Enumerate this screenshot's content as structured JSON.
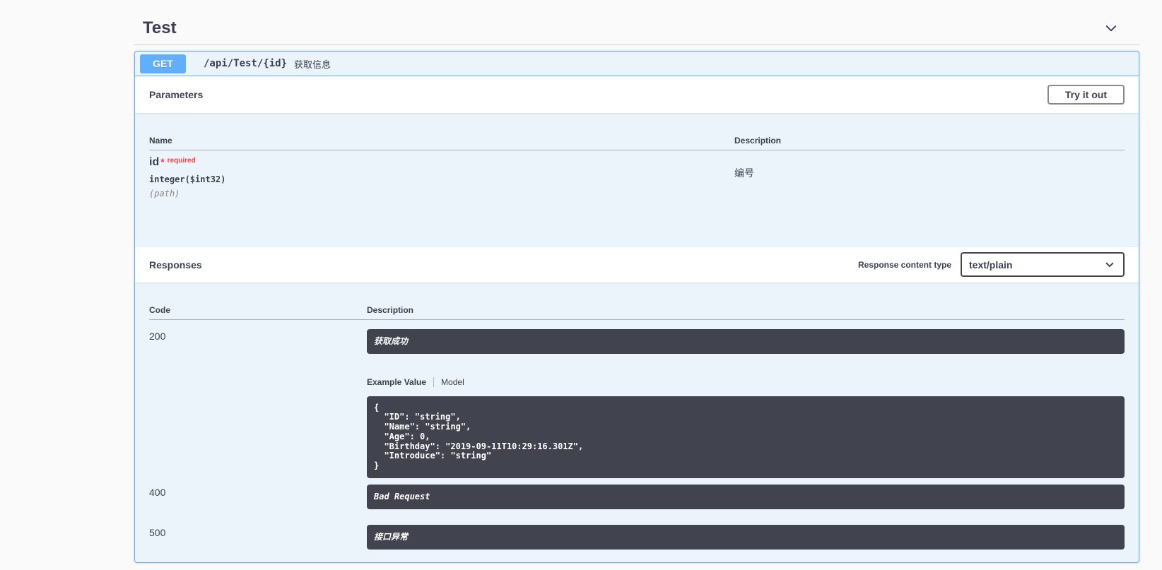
{
  "page": {
    "tag_title": "Test"
  },
  "operation": {
    "method": "GET",
    "path": "/api/Test/{id}",
    "summary": "获取信息"
  },
  "parameters": {
    "title": "Parameters",
    "try_it_out": "Try it out",
    "columns": {
      "name": "Name",
      "description": "Description"
    },
    "items": [
      {
        "name": "id",
        "required_star": "*",
        "required_label": "required",
        "type": "integer($int32)",
        "location": "(path)",
        "description": "编号"
      }
    ]
  },
  "responses": {
    "title": "Responses",
    "content_type_label": "Response content type",
    "content_type_value": "text/plain",
    "columns": {
      "code": "Code",
      "description": "Description"
    },
    "tabs": {
      "example": "Example Value",
      "model": "Model"
    },
    "rows": [
      {
        "code": "200",
        "description": "获取成功",
        "example": "{\n  \"ID\": \"string\",\n  \"Name\": \"string\",\n  \"Age\": 0,\n  \"Birthday\": \"2019-09-11T10:29:16.301Z\",\n  \"Introduce\": \"string\"\n}"
      },
      {
        "code": "400",
        "description": "Bad Request"
      },
      {
        "code": "500",
        "description": "接口异常"
      }
    ]
  },
  "icons": {
    "tag_collapse": "chevron-down",
    "select_arrow": "chevron-down"
  },
  "colors": {
    "accent_blue": "#61affe",
    "opblock_bg": "#ebf3fb",
    "dark_block": "#41444e",
    "text": "#3b4151",
    "required_red": "#f93e3e",
    "page_bg": "#fafafa"
  }
}
